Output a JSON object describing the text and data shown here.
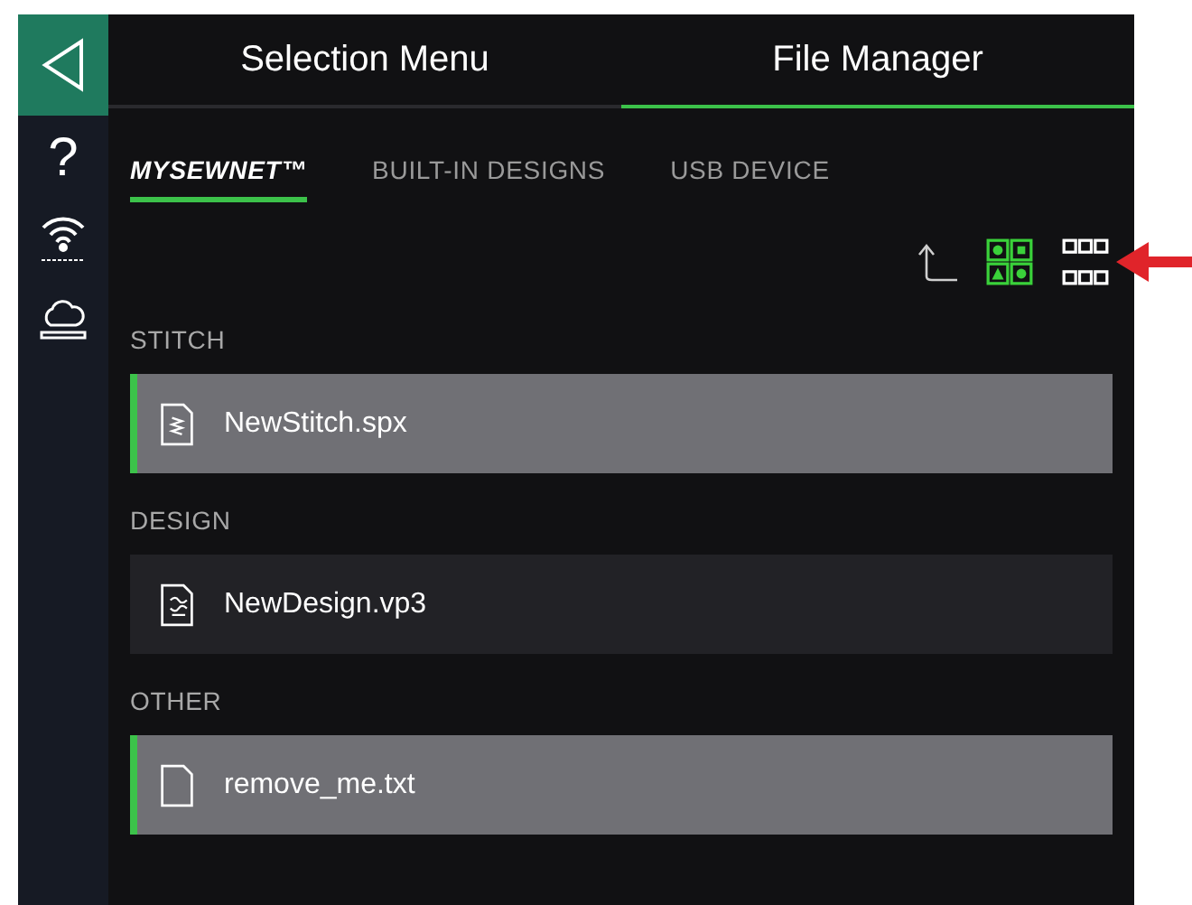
{
  "top_tabs": [
    {
      "label": "Selection Menu",
      "selected": false
    },
    {
      "label": "File Manager",
      "selected": true
    }
  ],
  "sub_tabs": [
    {
      "label": "MYSEWNET™",
      "selected": true
    },
    {
      "label": "BUILT-IN DESIGNS",
      "selected": false
    },
    {
      "label": "USB DEVICE",
      "selected": false
    }
  ],
  "view_buttons": [
    {
      "kind": "large",
      "selected": true
    },
    {
      "kind": "small",
      "selected": false
    }
  ],
  "sections": [
    {
      "title": "STITCH",
      "files": [
        {
          "name": "NewStitch.spx",
          "kind": "stitch",
          "selected": true
        }
      ]
    },
    {
      "title": "DESIGN",
      "files": [
        {
          "name": "NewDesign.vp3",
          "kind": "design",
          "selected": false
        }
      ]
    },
    {
      "title": "OTHER",
      "files": [
        {
          "name": "remove_me.txt",
          "kind": "other",
          "selected": true
        }
      ]
    }
  ],
  "side_buttons": [
    {
      "kind": "help",
      "label": "?"
    },
    {
      "kind": "wifi"
    },
    {
      "kind": "cloud"
    }
  ]
}
